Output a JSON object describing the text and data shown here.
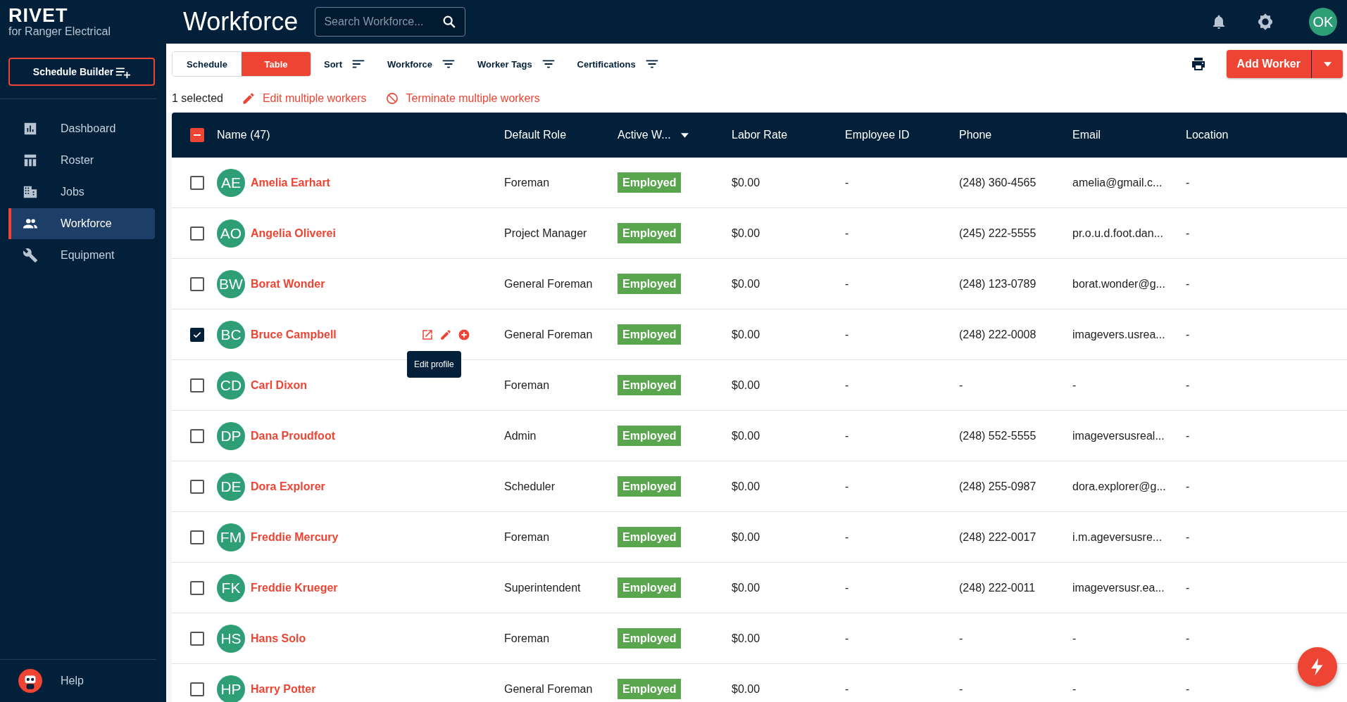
{
  "brand": {
    "name": "RIVET",
    "subtitle": "for Ranger Electrical"
  },
  "sidebar": {
    "builder_button": "Schedule Builder",
    "items": [
      {
        "label": "Dashboard",
        "selected": false
      },
      {
        "label": "Roster",
        "selected": false
      },
      {
        "label": "Jobs",
        "selected": false
      },
      {
        "label": "Workforce",
        "selected": true
      },
      {
        "label": "Equipment",
        "selected": false
      }
    ],
    "help": "Help"
  },
  "header": {
    "title": "Workforce",
    "search_placeholder": "Search Workforce...",
    "user_initials": "OK"
  },
  "view_tabs": [
    {
      "label": "Schedule",
      "selected": false
    },
    {
      "label": "Table",
      "selected": true
    }
  ],
  "filters": [
    "Sort",
    "Workforce",
    "Worker Tags",
    "Certifications"
  ],
  "add_button": "Add Worker",
  "selection": {
    "count": "1 selected",
    "edit": "Edit multiple workers",
    "terminate": "Terminate multiple workers"
  },
  "table": {
    "columns": [
      "Name (47)",
      "Default Role",
      "Active W...",
      "Labor Rate",
      "Employee ID",
      "Phone",
      "Email",
      "Location"
    ],
    "header_indeterminate": true,
    "rows": [
      {
        "initials": "AE",
        "name": "Amelia Earhart",
        "role": "Foreman",
        "status": "Employed",
        "rate": "$0.00",
        "employee_id": "-",
        "phone": "(248) 360-4565",
        "email": "amelia@gmail.c...",
        "location": "-",
        "checked": false,
        "hovered": false
      },
      {
        "initials": "AO",
        "name": "Angelia Oliverei",
        "role": "Project Manager",
        "status": "Employed",
        "rate": "$0.00",
        "employee_id": "-",
        "phone": "(245) 222-5555",
        "email": "pr.o.u.d.foot.dan...",
        "location": "-",
        "checked": false,
        "hovered": false
      },
      {
        "initials": "BW",
        "name": "Borat Wonder",
        "role": "General Foreman",
        "status": "Employed",
        "rate": "$0.00",
        "employee_id": "-",
        "phone": "(248) 123-0789",
        "email": "borat.wonder@g...",
        "location": "-",
        "checked": false,
        "hovered": false
      },
      {
        "initials": "BC",
        "name": "Bruce Campbell",
        "role": "General Foreman",
        "status": "Employed",
        "rate": "$0.00",
        "employee_id": "-",
        "phone": "(248) 222-0008",
        "email": "imagevers.usrea...",
        "location": "-",
        "checked": true,
        "hovered": true,
        "tooltip": "Edit profile"
      },
      {
        "initials": "CD",
        "name": "Carl Dixon",
        "role": "Foreman",
        "status": "Employed",
        "rate": "$0.00",
        "employee_id": "-",
        "phone": "-",
        "email": "-",
        "location": "-",
        "checked": false,
        "hovered": false
      },
      {
        "initials": "DP",
        "name": "Dana Proudfoot",
        "role": "Admin",
        "status": "Employed",
        "rate": "$0.00",
        "employee_id": "-",
        "phone": "(248) 552-5555",
        "email": "imageversusreal...",
        "location": "-",
        "checked": false,
        "hovered": false
      },
      {
        "initials": "DE",
        "name": "Dora Explorer",
        "role": "Scheduler",
        "status": "Employed",
        "rate": "$0.00",
        "employee_id": "-",
        "phone": "(248) 255-0987",
        "email": "dora.explorer@g...",
        "location": "-",
        "checked": false,
        "hovered": false
      },
      {
        "initials": "FM",
        "name": "Freddie Mercury",
        "role": "Foreman",
        "status": "Employed",
        "rate": "$0.00",
        "employee_id": "-",
        "phone": "(248) 222-0017",
        "email": "i.m.ageversusre...",
        "location": "-",
        "checked": false,
        "hovered": false
      },
      {
        "initials": "FK",
        "name": "Freddie Krueger",
        "role": "Superintendent",
        "status": "Employed",
        "rate": "$0.00",
        "employee_id": "-",
        "phone": "(248) 222-0011",
        "email": "imageversusr.ea...",
        "location": "-",
        "checked": false,
        "hovered": false
      },
      {
        "initials": "HS",
        "name": "Hans Solo",
        "role": "Foreman",
        "status": "Employed",
        "rate": "$0.00",
        "employee_id": "-",
        "phone": "-",
        "email": "-",
        "location": "-",
        "checked": false,
        "hovered": false
      },
      {
        "initials": "HP",
        "name": "Harry Potter",
        "role": "General Foreman",
        "status": "Employed",
        "rate": "$0.00",
        "employee_id": "-",
        "phone": "-",
        "email": "-",
        "location": "-",
        "checked": false,
        "hovered": false
      }
    ]
  }
}
